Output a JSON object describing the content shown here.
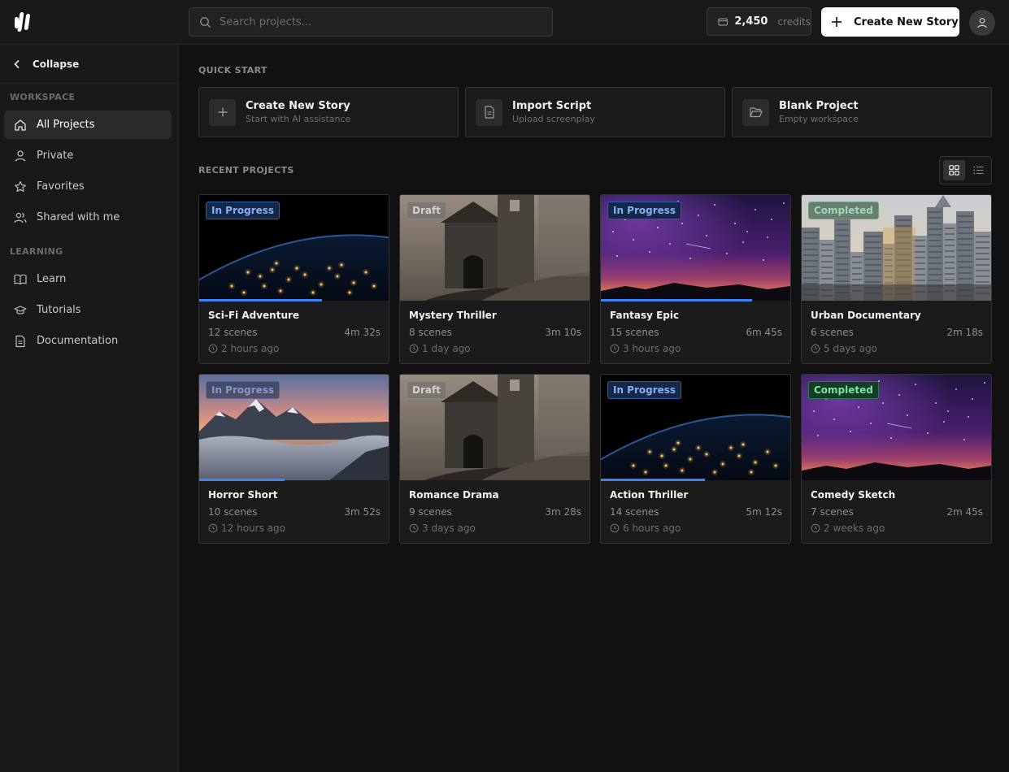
{
  "header": {
    "search_placeholder": "Search projects...",
    "credits_amount": "2,450",
    "credits_label": "credits",
    "create_button": "Create New Story"
  },
  "sidebar": {
    "collapse_label": "Collapse",
    "workspace_title": "WORKSPACE",
    "workspace_items": [
      "All Projects",
      "Private",
      "Favorites",
      "Shared with me"
    ],
    "learning_title": "LEARNING",
    "learning_items": [
      "Learn",
      "Tutorials",
      "Documentation"
    ]
  },
  "quick_start": {
    "title": "QUICK START",
    "cards": [
      {
        "title": "Create New Story",
        "subtitle": "Start with AI assistance"
      },
      {
        "title": "Import Script",
        "subtitle": "Upload screenplay"
      },
      {
        "title": "Blank Project",
        "subtitle": "Empty workspace"
      }
    ]
  },
  "recent": {
    "title": "RECENT PROJECTS",
    "projects": [
      {
        "title": "Sci-Fi Adventure",
        "scenes": "12 scenes",
        "duration": "4m 32s",
        "updated": "2 hours ago",
        "status": "In Progress",
        "progress": 0.65,
        "thumb": "earth-night"
      },
      {
        "title": "Mystery Thriller",
        "scenes": "8 scenes",
        "duration": "3m 10s",
        "updated": "1 day ago",
        "status": "Draft",
        "progress": 0,
        "thumb": "castle"
      },
      {
        "title": "Fantasy Epic",
        "scenes": "15 scenes",
        "duration": "6m 45s",
        "updated": "3 hours ago",
        "status": "In Progress",
        "progress": 0.8,
        "thumb": "galaxy"
      },
      {
        "title": "Urban Documentary",
        "scenes": "6 scenes",
        "duration": "2m 18s",
        "updated": "5 days ago",
        "status": "Completed",
        "progress": 0,
        "thumb": "city"
      },
      {
        "title": "Horror Short",
        "scenes": "10 scenes",
        "duration": "3m 52s",
        "updated": "12 hours ago",
        "status": "In Progress",
        "progress": 0.45,
        "thumb": "mountains"
      },
      {
        "title": "Romance Drama",
        "scenes": "9 scenes",
        "duration": "3m 28s",
        "updated": "3 days ago",
        "status": "Draft",
        "progress": 0,
        "thumb": "castle"
      },
      {
        "title": "Action Thriller",
        "scenes": "14 scenes",
        "duration": "5m 12s",
        "updated": "6 hours ago",
        "status": "In Progress",
        "progress": 0.55,
        "thumb": "earth-night"
      },
      {
        "title": "Comedy Sketch",
        "scenes": "7 scenes",
        "duration": "2m 45s",
        "updated": "2 weeks ago",
        "status": "Completed",
        "progress": 0,
        "thumb": "galaxy"
      }
    ]
  },
  "colors": {
    "accent_blue": "#3b82f6",
    "background": "#111111",
    "panel": "#191919"
  }
}
